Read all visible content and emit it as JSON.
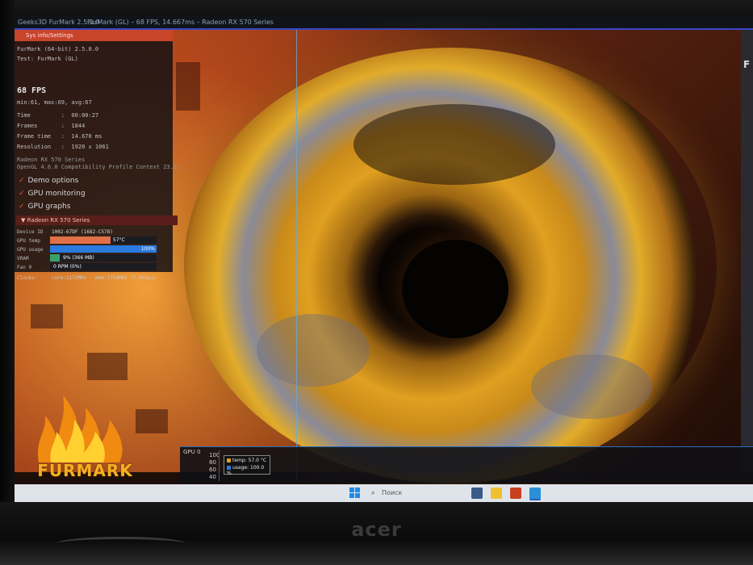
{
  "window": {
    "title_left": "Geeks3D FurMark 2.5.0.0",
    "title_right": "FurMark (GL) – 68 FPS, 14.667ms – Radeon RX 570 Series"
  },
  "panel": {
    "header": "Sys info/Settings",
    "lines": [
      "FurMark (64-bit) 2.5.0.0",
      "Test: FurMark (GL)"
    ],
    "fps": "68 FPS",
    "stats": [
      "min:61, max:69, avg:67",
      "Time         :  00:00:27",
      "Frames       :  1844",
      "Frame time   :  14.670 ms",
      "Resolution   :  1920 x 1061"
    ],
    "renderer": [
      "Radeon RX 570 Series",
      "OpenGL 4.6.0 Compatibility Profile Context 23.5..."
    ],
    "options": [
      "Demo options",
      "GPU monitoring",
      "GPU graphs"
    ]
  },
  "gpu": {
    "header": "Radeon RX 570 Series",
    "device_id_label": "Device ID",
    "device_id": "1002-67DF (1682-C578)",
    "temp_label": "GPU temp",
    "temp_text": "57°C",
    "temp_fraction": 0.57,
    "usage_label": "GPU usage",
    "usage_text": "100%",
    "usage_fraction": 1.0,
    "vram_label": "VRAM",
    "vram_text": "9% (366 MB)",
    "vram_fraction": 0.09,
    "fan_label": "Fan 0",
    "fan_text": "0 RPM (0%)",
    "clocks_label": "Clocks:",
    "clocks_text": "core:1172MHz - mem:1750MHz (7.0Gbps)"
  },
  "graph": {
    "label": "GPU 0",
    "axis": [
      "100",
      "80",
      "60",
      "40"
    ],
    "legend_temp": "temp: 57.0 °C",
    "legend_usage": "usage: 100.0 %"
  },
  "logo": {
    "text": "FURMARK"
  },
  "taskbar": {
    "search_placeholder": "Поиск"
  },
  "monitor": {
    "brand": "acer"
  },
  "overlay": {
    "right_letter": "F"
  },
  "colors": {
    "accent_red": "#c8452a",
    "temp_bar": "#e0704a",
    "usage_bar": "#2a7ae0",
    "vram_bar": "#3aa06a"
  }
}
